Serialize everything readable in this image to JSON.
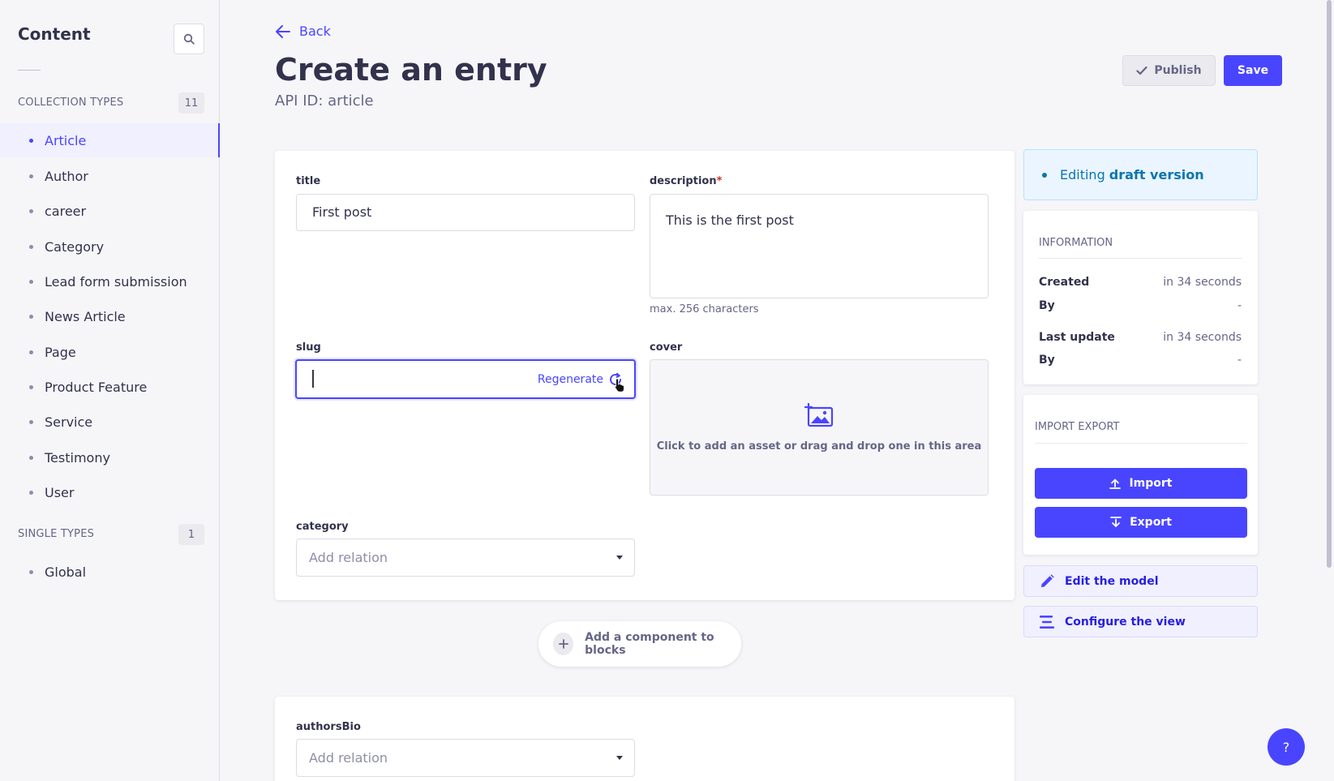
{
  "sidebar": {
    "title": "Content",
    "collection_types": {
      "label": "COLLECTION TYPES",
      "count": "11"
    },
    "items": [
      "Article",
      "Author",
      "career",
      "Category",
      "Lead form submission",
      "News Article",
      "Page",
      "Product Feature",
      "Service",
      "Testimony",
      "User"
    ],
    "single_types": {
      "label": "SINGLE TYPES",
      "count": "1"
    },
    "single_items": [
      "Global"
    ],
    "active_item": "Article"
  },
  "header": {
    "back_label": "Back",
    "title": "Create an entry",
    "subtitle": "API ID: article",
    "publish_label": "Publish",
    "save_label": "Save"
  },
  "form": {
    "title": {
      "label": "title",
      "value": "First post"
    },
    "description": {
      "label": "description",
      "required_mark": "*",
      "value": "This is the first post",
      "hint": "max. 256 characters"
    },
    "slug": {
      "label": "slug",
      "value": "",
      "regenerate_label": "Regenerate"
    },
    "cover": {
      "label": "cover",
      "prompt": "Click to add an asset or drag and drop one in this area"
    },
    "category": {
      "label": "category",
      "placeholder": "Add relation"
    },
    "add_component_label": "Add a component to blocks",
    "authors_bio": {
      "label": "authorsBio",
      "placeholder": "Add relation"
    }
  },
  "right_panel": {
    "draft_prefix": "Editing",
    "draft_strong": "draft version",
    "information": {
      "heading": "INFORMATION",
      "created_label": "Created",
      "created_value": "in 34 seconds",
      "created_by_label": "By",
      "created_by_value": "-",
      "updated_label": "Last update",
      "updated_value": "in 34 seconds",
      "updated_by_label": "By",
      "updated_by_value": "-"
    },
    "import_export": {
      "heading": "IMPORT EXPORT",
      "import_label": "Import",
      "export_label": "Export"
    },
    "edit_model_label": "Edit the model",
    "configure_view_label": "Configure the view"
  },
  "help_label": "?",
  "colors": {
    "primary": "#4945ff",
    "draft_text": "#0c75af",
    "required": "#d02b20"
  },
  "icons": [
    "search-icon",
    "arrow-left-icon",
    "check-icon",
    "refresh-icon",
    "cursor-icon",
    "image-add-icon",
    "plus-icon",
    "upload-icon",
    "download-icon",
    "pencil-icon",
    "list-icon"
  ]
}
